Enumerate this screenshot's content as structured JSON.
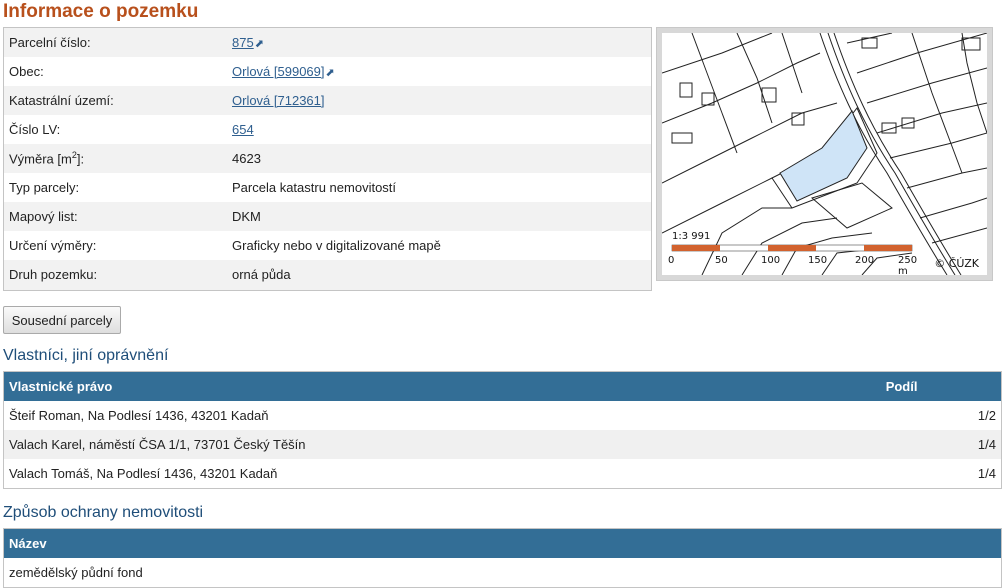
{
  "page_title": "Informace o pozemku",
  "info": {
    "parcel_number": {
      "label": "Parcelní číslo:",
      "value": "875"
    },
    "municipality": {
      "label": "Obec:",
      "value": "Orlová [599069]"
    },
    "cadastral_area": {
      "label": "Katastrální území:",
      "value": "Orlová [712361]"
    },
    "lv_number": {
      "label": "Číslo LV:",
      "value": "654"
    },
    "area": {
      "label_prefix": "Výměra [m",
      "label_sup": "2",
      "label_suffix": "]:",
      "value": "4623"
    },
    "parcel_type": {
      "label": "Typ parcely:",
      "value": "Parcela katastru nemovitostí"
    },
    "map_sheet": {
      "label": "Mapový list:",
      "value": "DKM"
    },
    "area_determination": {
      "label": "Určení výměry:",
      "value": "Graficky nebo v digitalizované mapě"
    },
    "land_type": {
      "label": "Druh pozemku:",
      "value": "orná půda"
    }
  },
  "map": {
    "scale_text": "1:3 991",
    "scale_ticks": [
      "0",
      "50",
      "100",
      "150",
      "200",
      "250 m"
    ],
    "copyright": "© ČÚZK",
    "highlight_color": "#cfe4f7",
    "scale_color": "#d2622e"
  },
  "neighbors_button": "Sousední parcely",
  "owners_section": {
    "title": "Vlastníci, jiní oprávnění",
    "header_name": "Vlastnické právo",
    "header_share": "Podíl",
    "rows": [
      {
        "name": "Šteif Roman, Na Podlesí 1436, 43201 Kadaň",
        "share": "1/2"
      },
      {
        "name": "Valach Karel, náměstí ČSA 1/1, 73701 Český Těšín",
        "share": "1/4"
      },
      {
        "name": "Valach Tomáš, Na Podlesí 1436, 43201 Kadaň",
        "share": "1/4"
      }
    ]
  },
  "protection_section": {
    "title": "Způsob ochrany nemovitosti",
    "header_name": "Název",
    "rows": [
      {
        "name": "zemědělský půdní fond"
      }
    ]
  },
  "colors": {
    "title": "#b8501c",
    "section": "#1f4e79",
    "table_header": "#336e96",
    "link": "#2f5f8f"
  }
}
